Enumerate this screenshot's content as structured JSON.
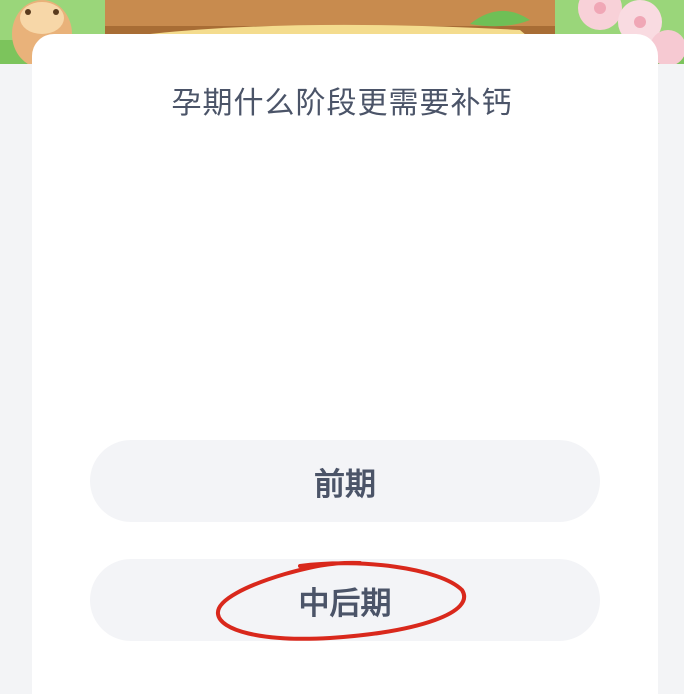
{
  "quiz": {
    "question": "孕期什么阶段更需要补钙",
    "options": [
      {
        "label": "前期"
      },
      {
        "label": "中后期"
      }
    ]
  },
  "colors": {
    "banner_green": "#8fd06b",
    "card_background": "#ffffff",
    "option_background": "#f3f4f7",
    "text": "#4b5468",
    "annotation_red": "#d9281c"
  }
}
